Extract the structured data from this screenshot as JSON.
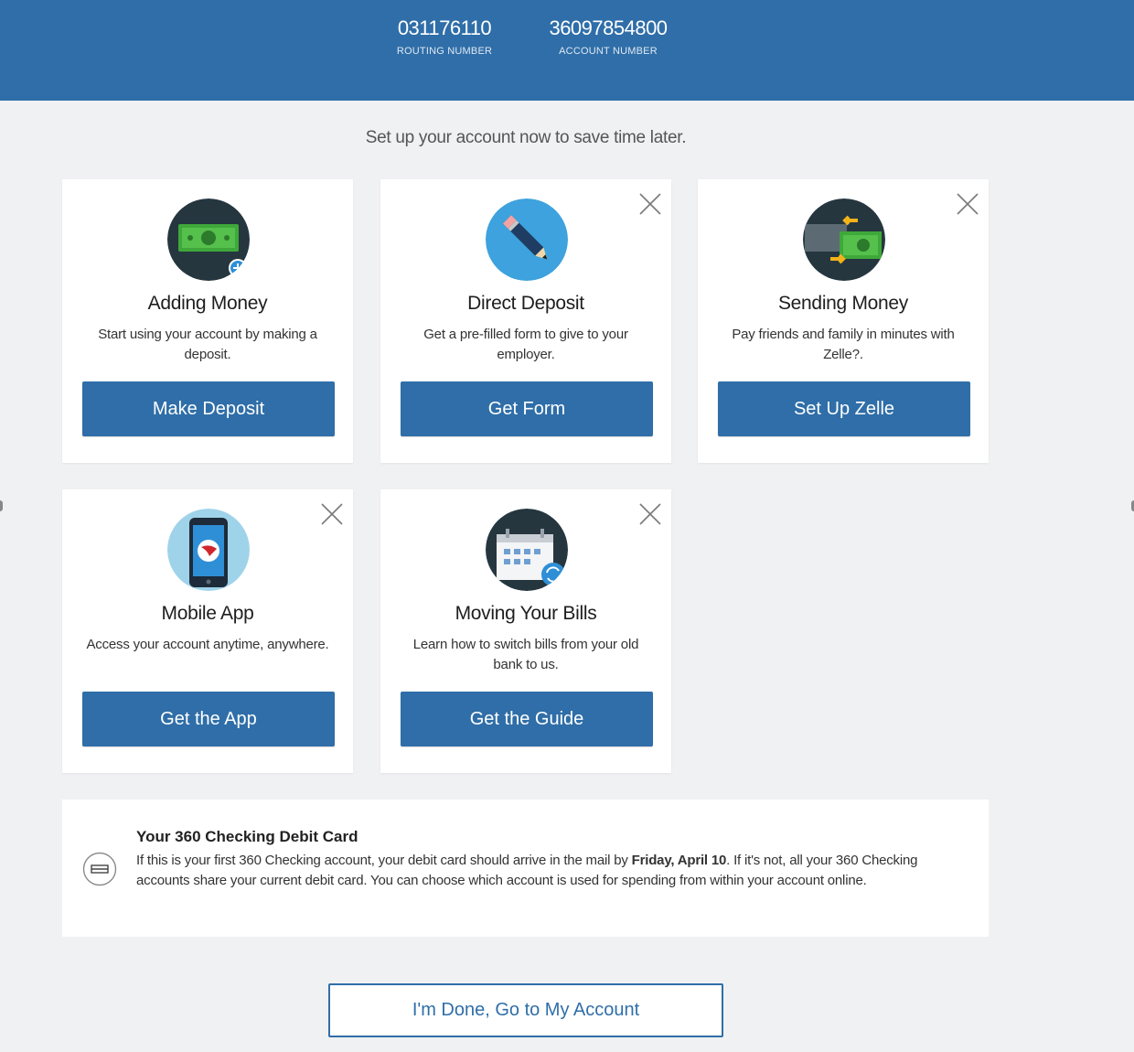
{
  "header": {
    "routing_number": "031176110",
    "routing_label": "ROUTING NUMBER",
    "account_number": "36097854800",
    "account_label": "ACCOUNT NUMBER"
  },
  "tagline": "Set up your account now to save time later.",
  "cards": [
    {
      "title": "Adding Money",
      "description": "Start using your account by making a deposit.",
      "button": "Make Deposit",
      "icon": "money-deposit-icon"
    },
    {
      "title": "Direct Deposit",
      "description": "Get a pre-filled form to give to your employer.",
      "button": "Get Form",
      "icon": "pencil-icon"
    },
    {
      "title": "Sending Money",
      "description": "Pay friends and family in minutes with Zelle?.",
      "button": "Set Up Zelle",
      "icon": "money-transfer-icon"
    },
    {
      "title": "Mobile App",
      "description": "Access your account anytime, anywhere.",
      "button": "Get the App",
      "icon": "mobile-phone-icon"
    },
    {
      "title": "Moving Your Bills",
      "description": "Learn how to switch bills from your old bank to us.",
      "button": "Get the Guide",
      "icon": "calendar-icon"
    }
  ],
  "debit_card": {
    "title": "Your 360 Checking Debit Card",
    "text_before": "If this is your first 360 Checking account, your debit card should arrive in the mail by ",
    "date": "Friday, April 10",
    "text_after": ". If it's not, all your 360 Checking accounts share your current debit card. You can choose which account is used for spending from within your account online."
  },
  "done_button": "I'm Done, Go to My Account",
  "colors": {
    "brand_blue": "#2f6ea8",
    "background": "#f0f1f3"
  }
}
